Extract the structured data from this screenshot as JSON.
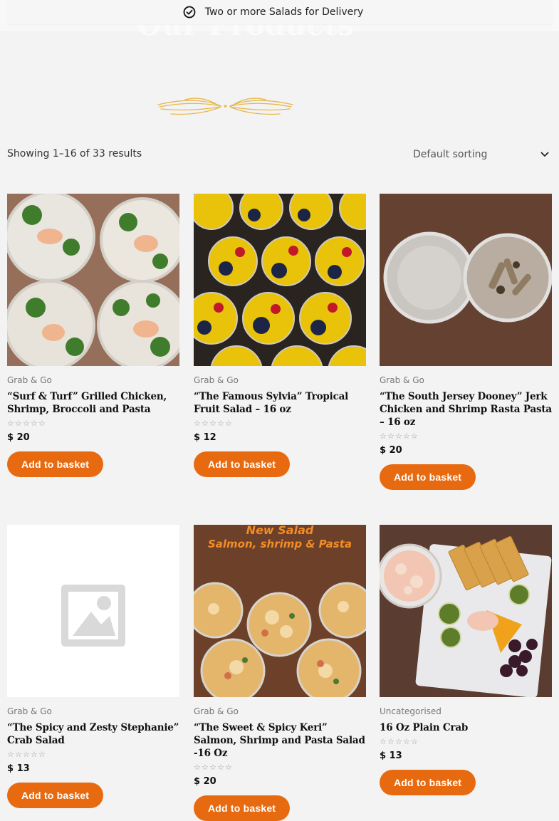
{
  "notice": {
    "text": "Two or more Salads for Delivery",
    "icon": "check-circle-icon"
  },
  "page_title": "Our Products",
  "result_count": "Showing 1–16 of 33 results",
  "sorting": {
    "selected": "Default sorting"
  },
  "products": [
    {
      "category": "Grab & Go",
      "name": "“Surf & Turf” Grilled Chicken, Shrimp, Broccoli and Pasta",
      "price": "$ 20",
      "button": "Add to basket",
      "rating_stars": 0
    },
    {
      "category": "Grab & Go",
      "name": "“The Famous Sylvia” Tropical Fruit Salad – 16 oz",
      "price": "$ 12",
      "button": "Add to basket",
      "rating_stars": 0
    },
    {
      "category": "Grab & Go",
      "name": "“The South Jersey Dooney” Jerk Chicken and Shrimp Rasta Pasta – 16 oz",
      "price": "$ 20",
      "button": "Add to basket",
      "rating_stars": 0
    },
    {
      "category": "Grab & Go",
      "name": "“The Spicy and Zesty Stephanie” Crab Salad",
      "price": "$ 13",
      "button": "Add to basket",
      "rating_stars": 0
    },
    {
      "category": "Grab & Go",
      "name": "“The Sweet & Spicy Keri” Salmon, Shrimp and Pasta Salad -16 Oz",
      "price": "$ 20",
      "button": "Add to basket",
      "rating_stars": 0,
      "image_overlay": [
        "New Salad",
        "Salmon, shrimp & Pasta"
      ]
    },
    {
      "category": "Uncategorised",
      "name": "16 Oz Plain Crab",
      "price": "$ 13",
      "button": "Add to basket",
      "rating_stars": 0
    }
  ],
  "colors": {
    "accent": "#e86a10",
    "flourish": "#e8b64a"
  }
}
